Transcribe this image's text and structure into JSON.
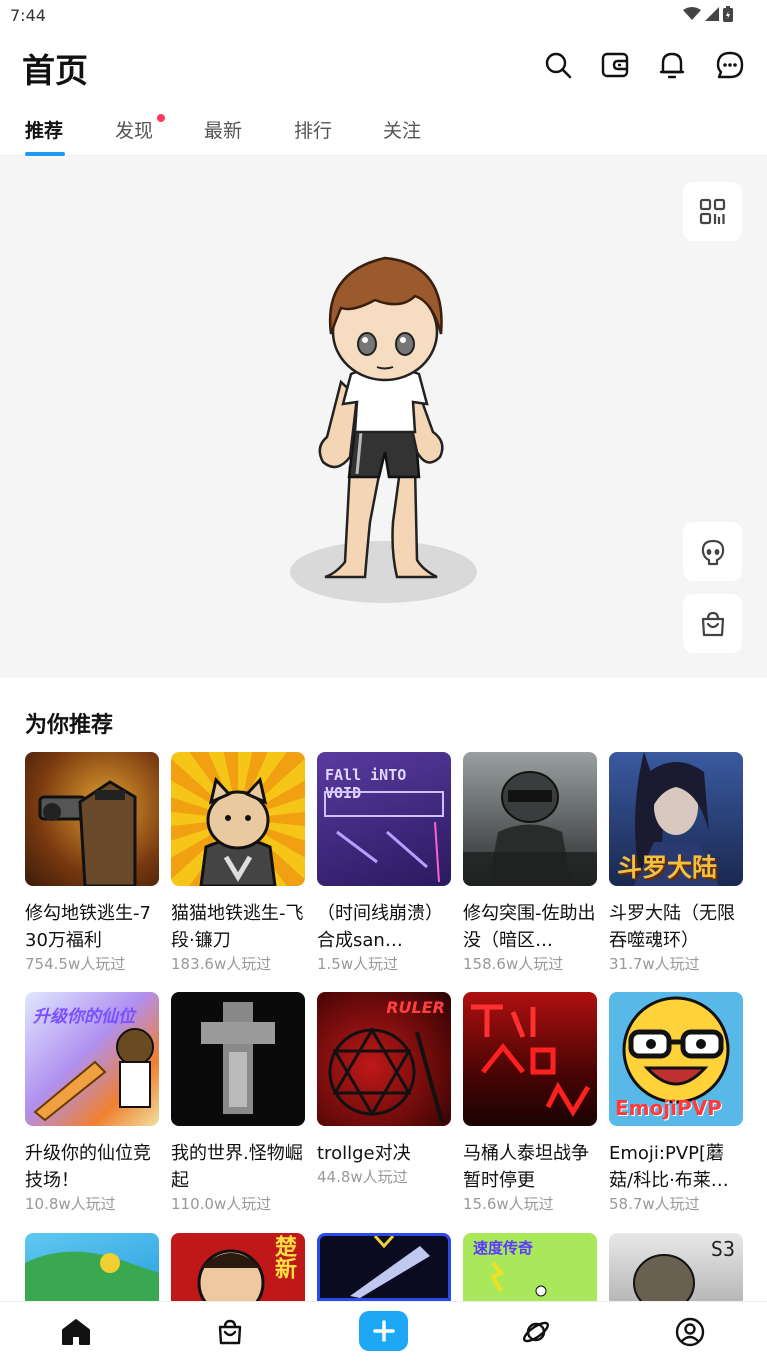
{
  "status_bar": {
    "time": "7:44"
  },
  "header": {
    "title": "首页"
  },
  "tabs": [
    {
      "label": "推荐",
      "active": true
    },
    {
      "label": "发现",
      "has_dot": true
    },
    {
      "label": "最新"
    },
    {
      "label": "排行"
    },
    {
      "label": "关注"
    }
  ],
  "section": {
    "title": "为你推荐"
  },
  "games": [
    {
      "name": "修勾地铁逃生-730万福利",
      "plays": "754.5w人玩过"
    },
    {
      "name": "猫猫地铁逃生-飞段·镰刀",
      "plays": "183.6w人玩过"
    },
    {
      "name": "（时间线崩溃）合成san…",
      "plays": "1.5w人玩过",
      "thumb_text": "FAll iNTO VOID"
    },
    {
      "name": "修勾突围-佐助出没（暗区…",
      "plays": "158.6w人玩过"
    },
    {
      "name": "斗罗大陆（无限吞噬魂环）",
      "plays": "31.7w人玩过",
      "thumb_text": "斗罗大陆"
    },
    {
      "name": "升级你的仙位竞技场！",
      "plays": "10.8w人玩过",
      "thumb_text": "升级你的仙位"
    },
    {
      "name": "我的世界.怪物崛起",
      "plays": "110.0w人玩过"
    },
    {
      "name": "trollge对决",
      "plays": "44.8w人玩过",
      "thumb_text": "RULER"
    },
    {
      "name": "马桶人泰坦战争 暂时停更",
      "plays": "15.6w人玩过"
    },
    {
      "name": "Emoji:PVP[蘑菇/科比·布莱…",
      "plays": "58.7w人玩过",
      "thumb_text": "EmojiPVP"
    }
  ],
  "partial_row_thumbs": [
    "",
    "楚新",
    "",
    "速度传奇",
    "S3"
  ],
  "colors": {
    "accent": "#1e9af5",
    "dot": "#ff3b5c"
  }
}
